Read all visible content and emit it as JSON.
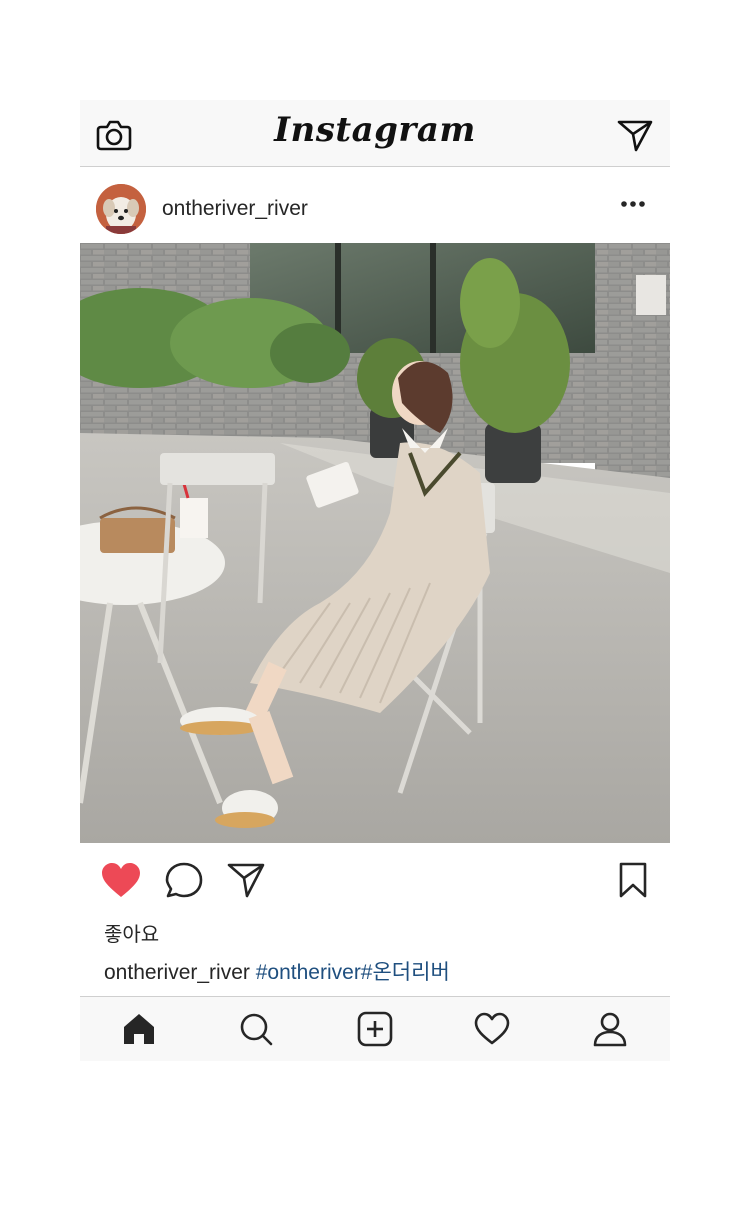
{
  "app": {
    "logo_text": "Instagram"
  },
  "topbar": {
    "camera_icon": "camera-icon",
    "direct_icon": "paper-plane-icon"
  },
  "post": {
    "username": "ontheriver_river",
    "avatar_icon": "dog-avatar",
    "more_icon": "more-dots-icon",
    "likes_label": "좋아요",
    "caption_user": "ontheriver_river",
    "caption_tags": "#ontheriver#온더리버",
    "liked": true
  },
  "actions": {
    "like_icon": "heart-filled-icon",
    "comment_icon": "comment-icon",
    "share_icon": "paper-plane-icon",
    "save_icon": "bookmark-icon"
  },
  "bottom_nav": [
    "home-icon",
    "search-icon",
    "add-post-icon",
    "activity-heart-icon",
    "profile-icon"
  ],
  "colors": {
    "like_red": "#ed4956",
    "hashtag_blue": "#1f4f7f",
    "bar_bg": "#f8f8f8"
  }
}
